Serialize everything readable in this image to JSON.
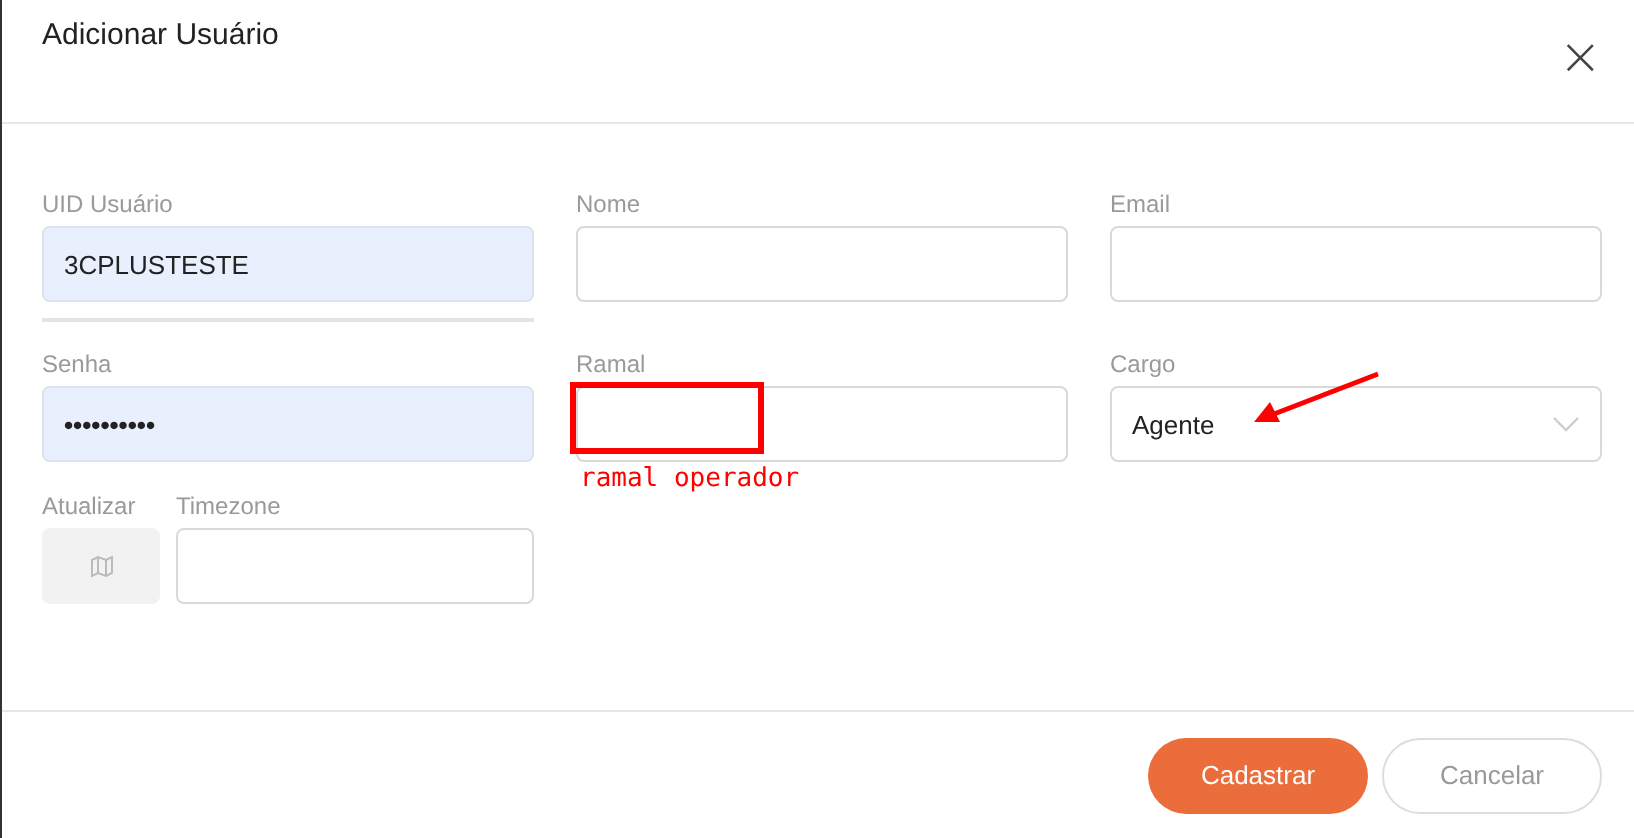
{
  "dialog": {
    "title": "Adicionar Usuário",
    "close": "×"
  },
  "rows": [
    [
      {
        "label": "UID Usuário",
        "kind": "text",
        "value": "3CPLUSTESTE",
        "autofilled": true
      },
      {
        "label": "Nome",
        "kind": "text",
        "autofilled": false
      },
      {
        "label": "Email",
        "kind": "text",
        "autofilled": false
      }
    ],
    [
      {
        "label": "Senha",
        "kind": "password",
        "value": "••••••••••",
        "autofilled": true
      },
      {
        "label": "Ramal",
        "kind": "text",
        "annotation": "ramal operador",
        "autofilled": false
      },
      {
        "label": "Cargo",
        "kind": "select",
        "value": "Agente",
        "arrow": true,
        "autofilled": false
      }
    ],
    [
      {
        "label": "Atualizar",
        "kind": "icon-button"
      },
      {
        "label": "Timezone",
        "kind": "text",
        "autofilled": false
      }
    ]
  ],
  "buttons": [
    {
      "label": "Cadastrar",
      "kind": "primary"
    },
    {
      "label": "Cancelar",
      "kind": "secondary"
    }
  ]
}
